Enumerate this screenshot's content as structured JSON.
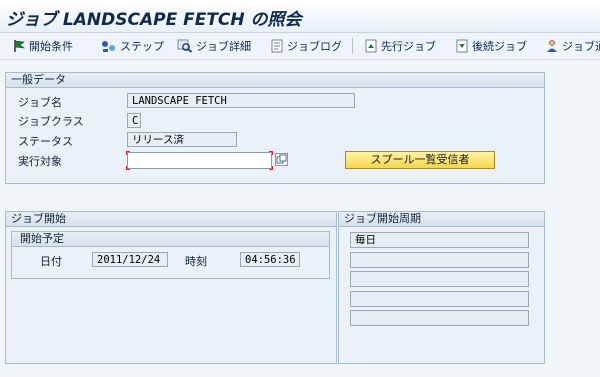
{
  "window": {
    "title": "ジョブ LANDSCAPE FETCH の照会"
  },
  "toolbar": {
    "items": [
      {
        "label": "開始条件",
        "icon": "flag-icon"
      },
      {
        "label": "ステップ",
        "icon": "steps-icon"
      },
      {
        "label": "ジョブ詳細",
        "icon": "magnifier-icon"
      },
      {
        "label": "ジョブログ",
        "icon": "log-icon"
      },
      {
        "label": "先行ジョブ",
        "icon": "predecessor-job-icon"
      },
      {
        "label": "後続ジョブ",
        "icon": "successor-job-icon"
      },
      {
        "label": "ジョブ通",
        "icon": "person-icon"
      }
    ]
  },
  "general_data": {
    "heading": "一般データ",
    "job_name_label": "ジョブ名",
    "job_name_value": "LANDSCAPE FETCH",
    "job_class_label": "ジョブクラス",
    "job_class_value": "C",
    "status_label": "ステータス",
    "status_value": "リリース済",
    "exec_target_label": "実行対象",
    "exec_target_value": "",
    "spool_button": "スプール一覧受信者"
  },
  "job_start": {
    "heading": "ジョブ開始",
    "planned_heading": "開始予定",
    "date_label": "日付",
    "date_value": "2011/12/24",
    "time_label": "時刻",
    "time_value": "04:56:36"
  },
  "job_period": {
    "heading": "ジョブ開始周期",
    "rows": [
      "毎日",
      "",
      "",
      "",
      ""
    ]
  },
  "colors": {
    "spool_button_bg": "#f6d54a",
    "required_marker": "#e02020"
  }
}
